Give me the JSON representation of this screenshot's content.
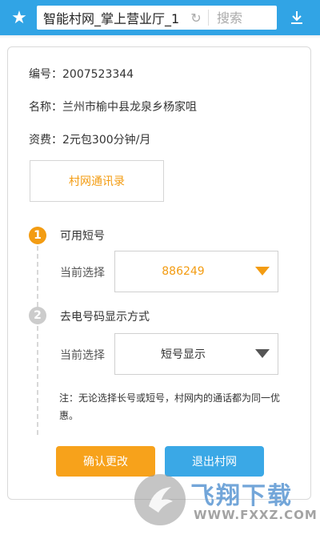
{
  "browser": {
    "url_title": "智能村网_掌上营业厅_1",
    "search_placeholder": "搜索",
    "icons": [
      "star-icon",
      "reload-icon",
      "download-icon"
    ]
  },
  "info": {
    "number_line": "编号：2007523344",
    "name_line": "名称：兰州市榆中县龙泉乡杨家咀",
    "fee_line": "资费：2元包300分钟/月"
  },
  "directory_button": "村网通讯录",
  "steps": [
    {
      "index": "1",
      "title": "可用短号",
      "select_label": "当前选择",
      "selected_value": "886249"
    },
    {
      "index": "2",
      "title": "去电号码显示方式",
      "select_label": "当前选择",
      "selected_value": "短号显示"
    }
  ],
  "note": "注：无论选择长号或短号，村网内的通话都为同一优惠。",
  "buttons": {
    "confirm": "确认更改",
    "exit": "退出村网"
  },
  "watermark": {
    "title": "飞翔下载",
    "url": "WWW.FXXZ.COM"
  },
  "colors": {
    "topbar": "#31a4e5",
    "accent_orange": "#f39c12",
    "confirm_button": "#f7a21b",
    "exit_button": "#3aa8e6",
    "step_inactive": "#cccccc"
  }
}
